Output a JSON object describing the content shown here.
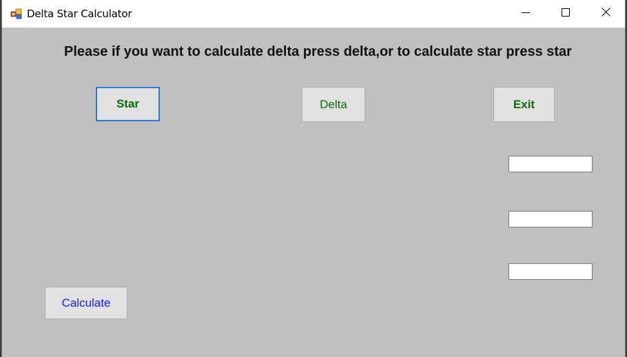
{
  "window": {
    "title": "Delta Star Calculator"
  },
  "main": {
    "instructions": "Please if you want to calculate delta press delta,or to calculate star press star",
    "buttons": {
      "star": "Star",
      "delta": "Delta",
      "exit": "Exit",
      "calculate": "Calculate"
    },
    "fields": [
      {
        "value": ""
      },
      {
        "value": ""
      },
      {
        "value": ""
      }
    ]
  },
  "icons": {
    "app": "app-icon",
    "minimize": "minimize-icon",
    "maximize": "maximize-icon",
    "close": "close-icon"
  },
  "colors": {
    "form_background": "#c0c0c0",
    "button_green_text": "#0b6e0b",
    "button_blue_text": "#1a1aff",
    "focus_border": "#2b7bd4"
  }
}
